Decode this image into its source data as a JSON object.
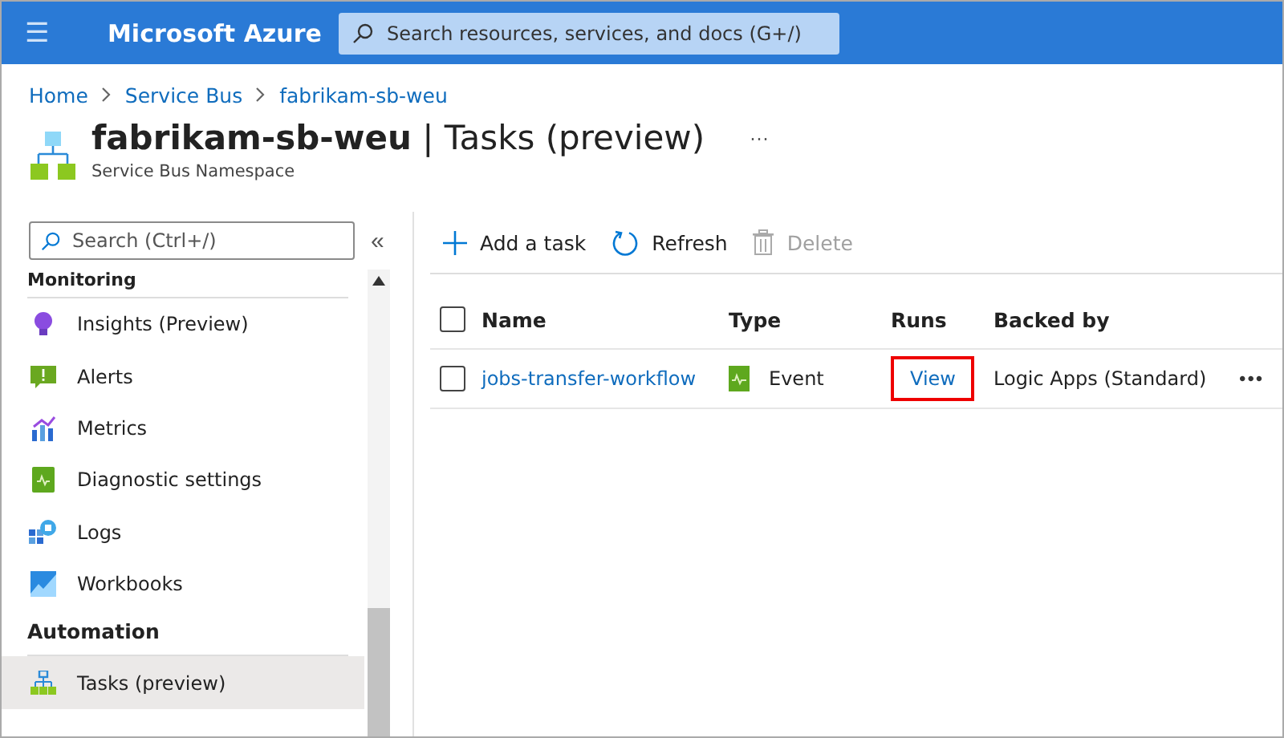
{
  "top_bar": {
    "menu_glyph": "☰",
    "brand": "Microsoft Azure",
    "search": {
      "placeholder": "Search resources, services, and docs (G+/)"
    }
  },
  "breadcrumb": [
    "Home",
    "Service Bus",
    "fabrikam-sb-weu"
  ],
  "header": {
    "title": "fabrikam-sb-weu",
    "subtitle_part": "| Tasks (preview)",
    "more": "···",
    "caption": "Service Bus Namespace"
  },
  "sidebar": {
    "search": {
      "placeholder": "Search (Ctrl+/)"
    },
    "collapse": "«",
    "items": [
      {
        "kind": "heading",
        "label": "Monitoring"
      },
      {
        "kind": "item",
        "label": "Insights (Preview)",
        "selected": false
      },
      {
        "kind": "item",
        "label": "Alerts",
        "selected": false
      },
      {
        "kind": "item",
        "label": "Metrics",
        "selected": false
      },
      {
        "kind": "item",
        "label": "Diagnostic settings",
        "selected": false
      },
      {
        "kind": "item",
        "label": "Logs",
        "selected": false
      },
      {
        "kind": "item",
        "label": "Workbooks",
        "selected": false
      },
      {
        "kind": "heading",
        "label": "Automation"
      },
      {
        "kind": "item",
        "label": "Tasks (preview)",
        "selected": true
      }
    ]
  },
  "toolbar": [
    {
      "kind": "add",
      "label": "Add a task",
      "disabled": false
    },
    {
      "kind": "refresh",
      "label": "Refresh",
      "disabled": false
    },
    {
      "kind": "delete",
      "label": "Delete",
      "disabled": true
    }
  ],
  "table": {
    "columns": [
      "Name",
      "Type",
      "Runs",
      "Backed by"
    ],
    "header_checked": false,
    "rows": [
      {
        "checked": false,
        "name": "jobs-transfer-workflow",
        "type": "Event",
        "runs": "View",
        "runs_highlighted": true,
        "backed_by": "Logic Apps (Standard)",
        "more": "•••"
      }
    ]
  }
}
